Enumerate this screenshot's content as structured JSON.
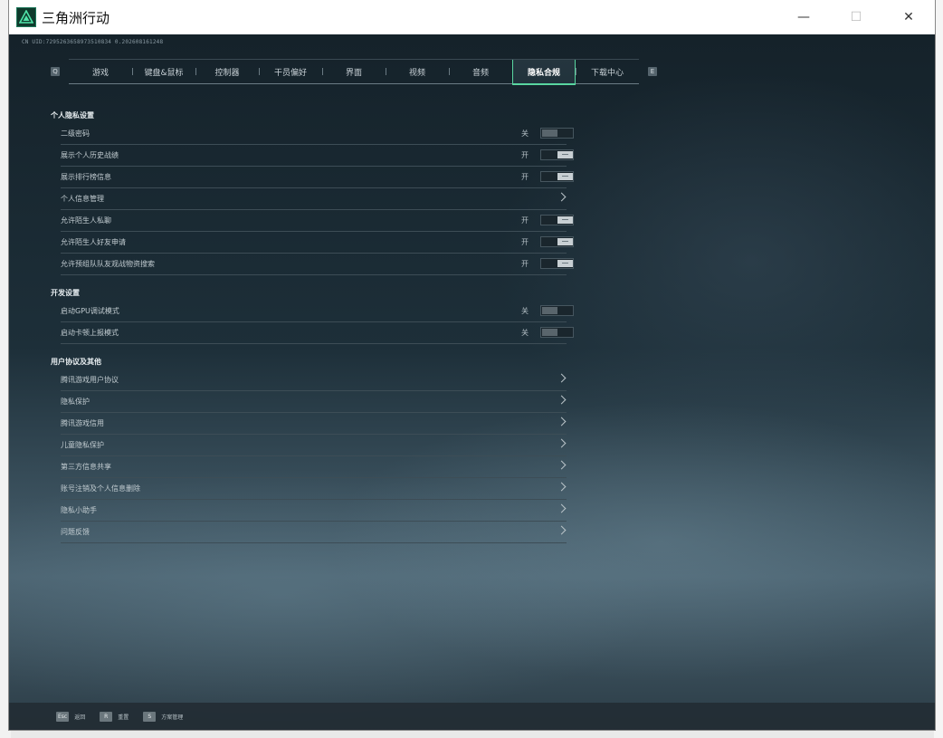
{
  "window": {
    "title": "三角洲行动",
    "controls": {
      "minimize": "—",
      "maximize": "☐",
      "close": "✕"
    }
  },
  "uid": "CN UID:7295263658973510834 0.202608161248",
  "tabbar": {
    "prev_key": "Q",
    "next_key": "E",
    "tabs": [
      {
        "label": "游戏",
        "width": 70
      },
      {
        "label": "键盘&鼠标",
        "width": 70
      },
      {
        "label": "控制器",
        "width": 70
      },
      {
        "label": "干员偏好",
        "width": 70
      },
      {
        "label": "界面",
        "width": 70
      },
      {
        "label": "视频",
        "width": 70
      },
      {
        "label": "音频",
        "width": 70
      },
      {
        "label": "隐私合规",
        "width": 68,
        "active": true
      },
      {
        "label": "下载中心",
        "width": 70
      }
    ]
  },
  "sections": [
    {
      "title": "个人隐私设置",
      "rows": [
        {
          "label": "二级密码",
          "type": "toggle",
          "state": "关",
          "on": false
        },
        {
          "label": "展示个人历史战绩",
          "type": "toggle",
          "state": "开",
          "on": true
        },
        {
          "label": "展示排行榜信息",
          "type": "toggle",
          "state": "开",
          "on": true
        },
        {
          "label": "个人信息管理",
          "type": "link"
        },
        {
          "label": "允许陌生人私聊",
          "type": "toggle",
          "state": "开",
          "on": true
        },
        {
          "label": "允许陌生人好友申请",
          "type": "toggle",
          "state": "开",
          "on": true
        },
        {
          "label": "允许预组队队友观战物资搜索",
          "type": "toggle",
          "state": "开",
          "on": true
        }
      ]
    },
    {
      "title": "开发设置",
      "rows": [
        {
          "label": "启动GPU调试模式",
          "type": "toggle",
          "state": "关",
          "on": false
        },
        {
          "label": "启动卡顿上报模式",
          "type": "toggle",
          "state": "关",
          "on": false
        }
      ]
    },
    {
      "title": "用户协议及其他",
      "rows": [
        {
          "label": "腾讯游戏用户协议",
          "type": "link"
        },
        {
          "label": "隐私保护",
          "type": "link"
        },
        {
          "label": "腾讯游戏信用",
          "type": "link"
        },
        {
          "label": "儿童隐私保护",
          "type": "link"
        },
        {
          "label": "第三方信息共享",
          "type": "link"
        },
        {
          "label": "账号注销及个人信息删除",
          "type": "link"
        },
        {
          "label": "隐私小助手",
          "type": "link"
        },
        {
          "label": "问题反馈",
          "type": "link"
        }
      ]
    }
  ],
  "bottombar": {
    "hints": [
      {
        "key": "Esc",
        "label": "返回"
      },
      {
        "key": "R",
        "label": "重置"
      },
      {
        "key": "S",
        "label": "方案管理"
      }
    ]
  }
}
